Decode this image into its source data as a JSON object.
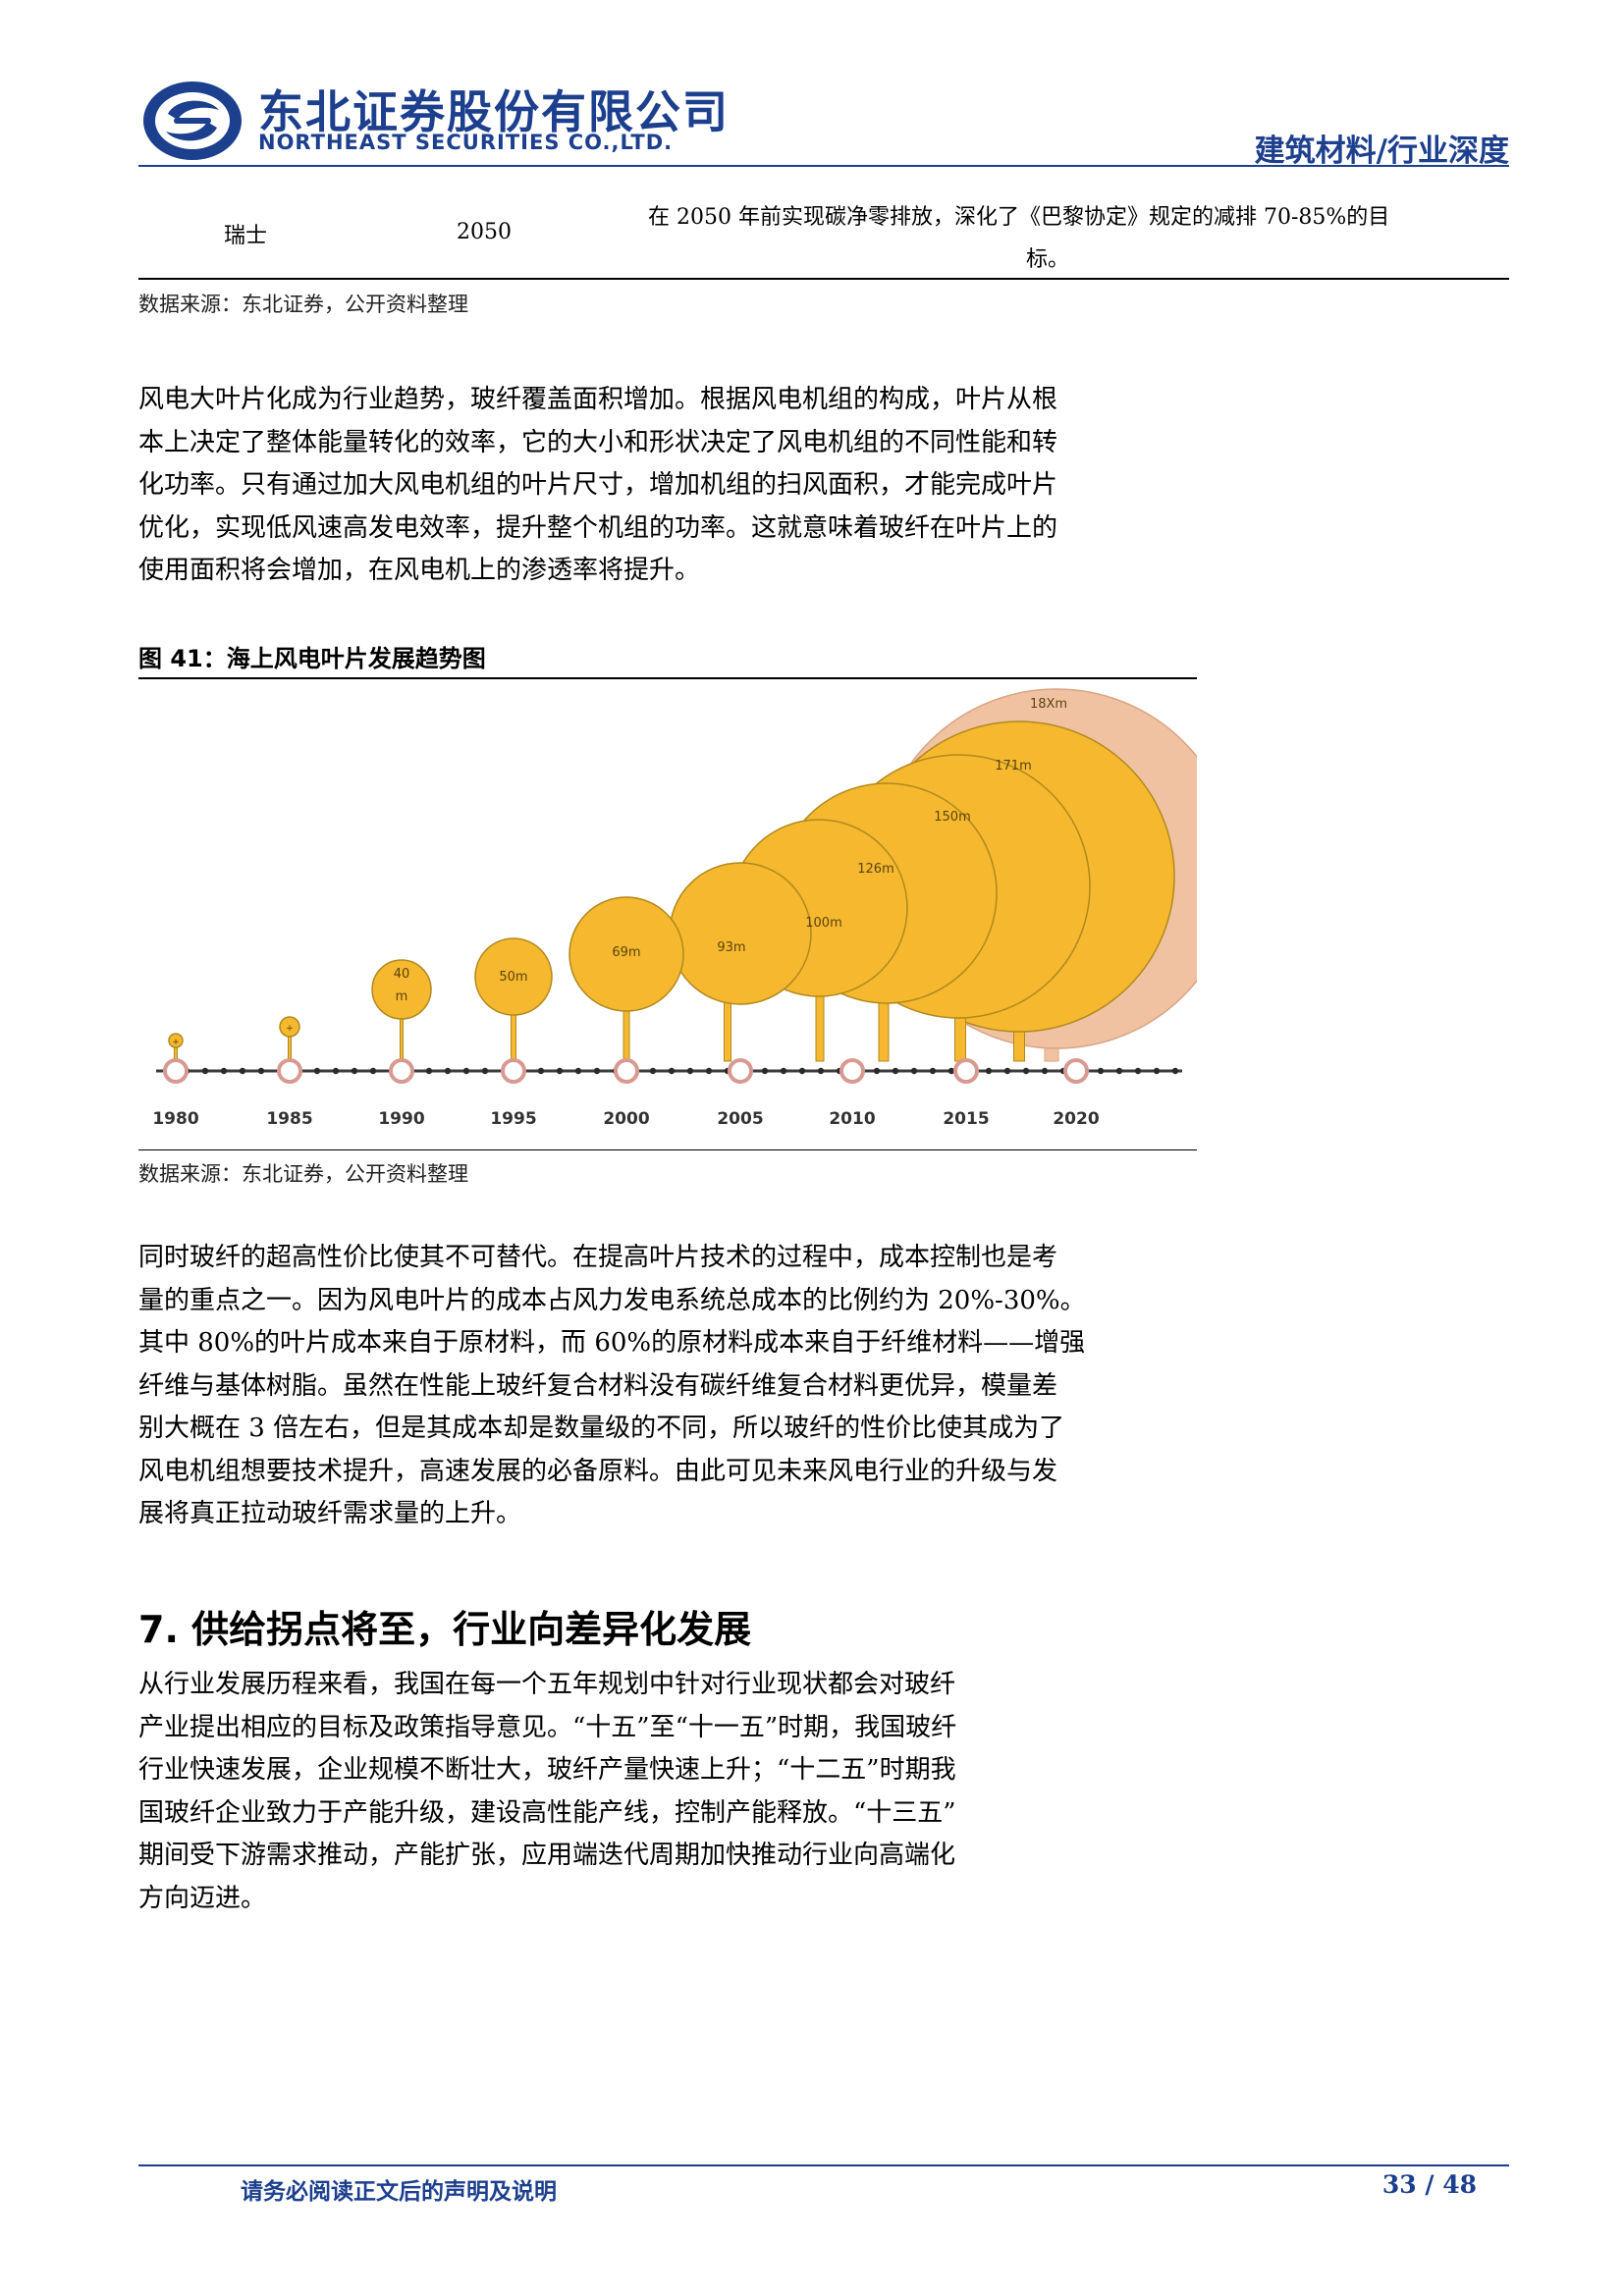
{
  "header": {
    "company_cn": "东北证券股份有限公司",
    "company_en": "NORTHEAST SECURITIES CO.,LTD.",
    "category": "建筑材料/行业深度",
    "brand_color": "#1c3f8e"
  },
  "table_row": {
    "country": "瑞士",
    "year": "2050",
    "goal_line1": "在 2050 年前实现碳净零排放，深化了《巴黎协定》规定的减排 70-85%的目",
    "goal_line2": "标。"
  },
  "source_note_1": "数据来源：东北证券，公开资料整理",
  "para1": [
    "风电大叶片化成为行业趋势，玻纤覆盖面积增加。根据风电机组的构成，叶片从根",
    "本上决定了整体能量转化的效率，它的大小和形状决定了风电机组的不同性能和转",
    "化功率。只有通过加大风电机组的叶片尺寸，增加机组的扫风面积，才能完成叶片",
    "优化，实现低风速高发电效率，提升整个机组的功率。这就意味着玻纤在叶片上的",
    "使用面积将会增加，在风电机上的渗透率将提升。"
  ],
  "figure": {
    "title": "图 41：海上风电叶片发展趋势图"
  },
  "chart_data": {
    "type": "bubble-timeline",
    "x": [
      "1980",
      "1985",
      "1990",
      "1995",
      "2000",
      "2005",
      "2010",
      "2015",
      "2020"
    ],
    "bubble_labels": [
      "",
      "",
      "40 m",
      "50m",
      "69m",
      "93m",
      "100m",
      "126m",
      "150m",
      "171m",
      "18Xm"
    ],
    "colors": {
      "bubble": "#f5b82e",
      "outline": "#b0891d",
      "future": "#f0c2a2",
      "timeline": "#3a3a3a",
      "node": "#d89a90"
    }
  },
  "source_note_2": "数据来源：东北证券，公开资料整理",
  "para2": [
    "同时玻纤的超高性价比使其不可替代。在提高叶片技术的过程中，成本控制也是考",
    "量的重点之一。因为风电叶片的成本占风力发电系统总成本的比例约为 20%-30%。",
    "其中 80%的叶片成本来自于原材料，而 60%的原材料成本来自于纤维材料——增强",
    "纤维与基体树脂。虽然在性能上玻纤复合材料没有碳纤维复合材料更优异，模量差",
    "别大概在 3 倍左右，但是其成本却是数量级的不同，所以玻纤的性价比使其成为了",
    "风电机组想要技术提升，高速发展的必备原料。由此可见未来风电行业的升级与发",
    "展将真正拉动玻纤需求量的上升。"
  ],
  "section": {
    "heading": "7.  供给拐点将至，行业向差异化发展"
  },
  "para3": [
    "从行业发展历程来看，我国在每一个五年规划中针对行业现状都会对玻纤",
    "产业提出相应的目标及政策指导意见。“十五”至“十一五”时期，我国玻纤",
    "行业快速发展，企业规模不断壮大，玻纤产量快速上升；“十二五”时期我",
    "国玻纤企业致力于产能升级，建设高性能产线，控制产能释放。“十三五”",
    "期间受下游需求推动，产能扩张，应用端迭代周期加快推动行业向高端化",
    "方向迈进。"
  ],
  "footer": {
    "disclaimer": "请务必阅读正文后的声明及说明",
    "page": "33 / 48"
  }
}
